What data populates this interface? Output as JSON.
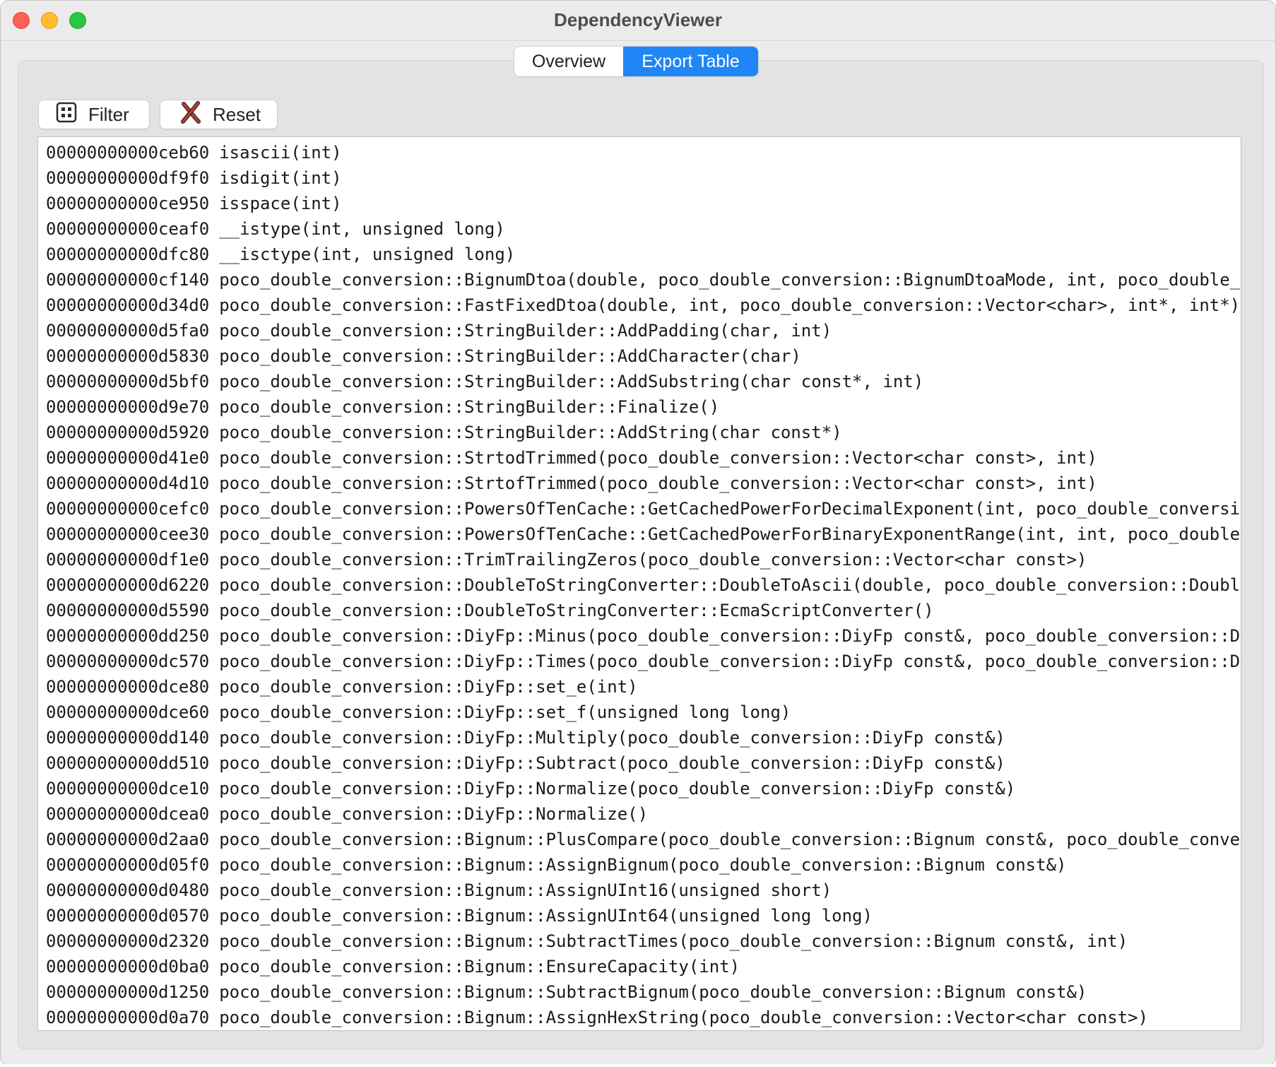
{
  "window": {
    "title": "DependencyViewer"
  },
  "tabs": [
    {
      "label": "Overview",
      "selected": false
    },
    {
      "label": "Export Table",
      "selected": true
    }
  ],
  "toolbar": {
    "filter_label": "Filter",
    "filter_icon": "grid-icon",
    "reset_label": "Reset",
    "reset_icon": "x-mark-icon"
  },
  "colors": {
    "accent": "#1f86f5",
    "close": "#fe5f57",
    "minimize": "#febc2e",
    "maximize": "#28c840",
    "reset_icon": "#c0392b"
  },
  "exports": [
    {
      "address": "00000000000ceb60",
      "symbol": "isascii(int)"
    },
    {
      "address": "00000000000df9f0",
      "symbol": "isdigit(int)"
    },
    {
      "address": "00000000000ce950",
      "symbol": "isspace(int)"
    },
    {
      "address": "00000000000ceaf0",
      "symbol": "__istype(int, unsigned long)"
    },
    {
      "address": "00000000000dfc80",
      "symbol": "__isctype(int, unsigned long)"
    },
    {
      "address": "00000000000cf140",
      "symbol": "poco_double_conversion::BignumDtoa(double, poco_double_conversion::BignumDtoaMode, int, poco_double_c"
    },
    {
      "address": "00000000000d34d0",
      "symbol": "poco_double_conversion::FastFixedDtoa(double, int, poco_double_conversion::Vector<char>, int*, int*)"
    },
    {
      "address": "00000000000d5fa0",
      "symbol": "poco_double_conversion::StringBuilder::AddPadding(char, int)"
    },
    {
      "address": "00000000000d5830",
      "symbol": "poco_double_conversion::StringBuilder::AddCharacter(char)"
    },
    {
      "address": "00000000000d5bf0",
      "symbol": "poco_double_conversion::StringBuilder::AddSubstring(char const*, int)"
    },
    {
      "address": "00000000000d9e70",
      "symbol": "poco_double_conversion::StringBuilder::Finalize()"
    },
    {
      "address": "00000000000d5920",
      "symbol": "poco_double_conversion::StringBuilder::AddString(char const*)"
    },
    {
      "address": "00000000000d41e0",
      "symbol": "poco_double_conversion::StrtodTrimmed(poco_double_conversion::Vector<char const>, int)"
    },
    {
      "address": "00000000000d4d10",
      "symbol": "poco_double_conversion::StrtofTrimmed(poco_double_conversion::Vector<char const>, int)"
    },
    {
      "address": "00000000000cefc0",
      "symbol": "poco_double_conversion::PowersOfTenCache::GetCachedPowerForDecimalExponent(int, poco_double_conversio"
    },
    {
      "address": "00000000000cee30",
      "symbol": "poco_double_conversion::PowersOfTenCache::GetCachedPowerForBinaryExponentRange(int, int, poco_double_"
    },
    {
      "address": "00000000000df1e0",
      "symbol": "poco_double_conversion::TrimTrailingZeros(poco_double_conversion::Vector<char const>)"
    },
    {
      "address": "00000000000d6220",
      "symbol": "poco_double_conversion::DoubleToStringConverter::DoubleToAscii(double, poco_double_conversion::Double"
    },
    {
      "address": "00000000000d5590",
      "symbol": "poco_double_conversion::DoubleToStringConverter::EcmaScriptConverter()"
    },
    {
      "address": "00000000000dd250",
      "symbol": "poco_double_conversion::DiyFp::Minus(poco_double_conversion::DiyFp const&, poco_double_conversion::Di"
    },
    {
      "address": "00000000000dc570",
      "symbol": "poco_double_conversion::DiyFp::Times(poco_double_conversion::DiyFp const&, poco_double_conversion::Di"
    },
    {
      "address": "00000000000dce80",
      "symbol": "poco_double_conversion::DiyFp::set_e(int)"
    },
    {
      "address": "00000000000dce60",
      "symbol": "poco_double_conversion::DiyFp::set_f(unsigned long long)"
    },
    {
      "address": "00000000000dd140",
      "symbol": "poco_double_conversion::DiyFp::Multiply(poco_double_conversion::DiyFp const&)"
    },
    {
      "address": "00000000000dd510",
      "symbol": "poco_double_conversion::DiyFp::Subtract(poco_double_conversion::DiyFp const&)"
    },
    {
      "address": "00000000000dce10",
      "symbol": "poco_double_conversion::DiyFp::Normalize(poco_double_conversion::DiyFp const&)"
    },
    {
      "address": "00000000000dcea0",
      "symbol": "poco_double_conversion::DiyFp::Normalize()"
    },
    {
      "address": "00000000000d2aa0",
      "symbol": "poco_double_conversion::Bignum::PlusCompare(poco_double_conversion::Bignum const&, poco_double_conver"
    },
    {
      "address": "00000000000d05f0",
      "symbol": "poco_double_conversion::Bignum::AssignBignum(poco_double_conversion::Bignum const&)"
    },
    {
      "address": "00000000000d0480",
      "symbol": "poco_double_conversion::Bignum::AssignUInt16(unsigned short)"
    },
    {
      "address": "00000000000d0570",
      "symbol": "poco_double_conversion::Bignum::AssignUInt64(unsigned long long)"
    },
    {
      "address": "00000000000d2320",
      "symbol": "poco_double_conversion::Bignum::SubtractTimes(poco_double_conversion::Bignum const&, int)"
    },
    {
      "address": "00000000000d0ba0",
      "symbol": "poco_double_conversion::Bignum::EnsureCapacity(int)"
    },
    {
      "address": "00000000000d1250",
      "symbol": "poco_double_conversion::Bignum::SubtractBignum(poco_double_conversion::Bignum const&)"
    },
    {
      "address": "00000000000d0a70",
      "symbol": "poco_double_conversion::Bignum::AssignHexString(poco_double_conversion::Vector<char const>)"
    }
  ]
}
